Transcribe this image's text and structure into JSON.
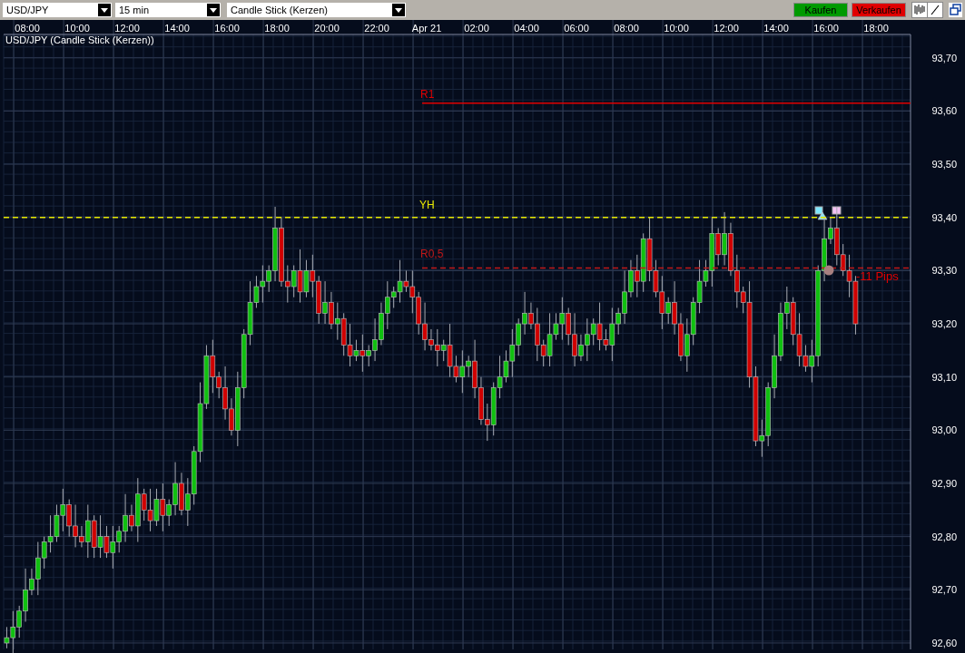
{
  "toolbar": {
    "selects": [
      {
        "value": "USD/JPY"
      },
      {
        "value": "15 min"
      },
      {
        "value": "Candle Stick (Kerzen)"
      }
    ],
    "buttons": [
      {
        "label": "Kaufen",
        "kind": "buy"
      },
      {
        "label": "Verkaufen",
        "kind": "sell"
      }
    ]
  },
  "chart": {
    "chart_data": {
      "type": "candlestick",
      "title": "USD/JPY (Candle Stick (Kerzen))",
      "categories": [
        null,
        null,
        null,
        "08:00",
        null,
        null,
        null,
        null,
        null,
        null,
        null,
        "10:00",
        null,
        null,
        null,
        null,
        null,
        null,
        null,
        "12:00",
        null,
        null,
        null,
        null,
        null,
        null,
        null,
        "14:00",
        null,
        null,
        null,
        null,
        null,
        null,
        null,
        "16:00",
        null,
        null,
        null,
        null,
        null,
        null,
        null,
        "18:00",
        null,
        null,
        null,
        null,
        null,
        null,
        null,
        "20:00",
        null,
        null,
        null,
        null,
        null,
        null,
        null,
        "22:00",
        null,
        null,
        null,
        null,
        null,
        null,
        null,
        "Apr 21",
        null,
        null,
        null,
        null,
        null,
        null,
        null,
        "02:00",
        null,
        null,
        null,
        null,
        null,
        null,
        null,
        "04:00",
        null,
        null,
        null,
        null,
        null,
        null,
        null,
        "06:00",
        null,
        null,
        null,
        null,
        null,
        null,
        null,
        "08:00",
        null,
        null,
        null,
        null,
        null,
        null,
        null,
        "10:00",
        null,
        null,
        null,
        null,
        null,
        null,
        null,
        "12:00",
        null,
        null,
        null,
        null,
        null,
        null,
        null,
        "14:00",
        null,
        null,
        null,
        null,
        null,
        null,
        null,
        "16:00",
        null,
        null,
        null,
        null,
        null,
        null,
        null,
        "18:00",
        null
      ],
      "ohlc": [
        [
          92.6,
          92.63,
          92.59,
          92.61
        ],
        [
          92.61,
          92.66,
          92.58,
          92.63
        ],
        [
          92.63,
          92.67,
          92.61,
          92.66
        ],
        [
          92.66,
          92.74,
          92.64,
          92.7
        ],
        [
          92.7,
          92.74,
          92.69,
          92.72
        ],
        [
          92.72,
          92.79,
          92.69,
          92.76
        ],
        [
          92.76,
          92.8,
          92.74,
          92.79
        ],
        [
          92.79,
          92.84,
          92.77,
          92.8
        ],
        [
          92.8,
          92.86,
          92.79,
          92.84
        ],
        [
          92.84,
          92.89,
          92.81,
          92.86
        ],
        [
          92.86,
          92.87,
          92.8,
          92.82
        ],
        [
          92.82,
          92.86,
          92.78,
          92.8
        ],
        [
          92.8,
          92.82,
          92.78,
          92.79
        ],
        [
          92.79,
          92.86,
          92.76,
          92.83
        ],
        [
          92.83,
          92.84,
          92.76,
          92.78
        ],
        [
          92.78,
          92.84,
          92.76,
          92.8
        ],
        [
          92.8,
          92.82,
          92.76,
          92.77
        ],
        [
          92.77,
          92.82,
          92.74,
          92.79
        ],
        [
          92.79,
          92.82,
          92.77,
          92.81
        ],
        [
          92.81,
          92.88,
          92.79,
          92.84
        ],
        [
          92.84,
          92.86,
          92.81,
          92.82
        ],
        [
          92.82,
          92.91,
          92.79,
          92.88
        ],
        [
          92.88,
          92.89,
          92.83,
          92.85
        ],
        [
          92.85,
          92.89,
          92.81,
          92.83
        ],
        [
          92.83,
          92.89,
          92.82,
          92.87
        ],
        [
          92.87,
          92.9,
          92.81,
          92.84
        ],
        [
          92.84,
          92.87,
          92.82,
          92.86
        ],
        [
          92.86,
          92.94,
          92.84,
          92.9
        ],
        [
          92.9,
          92.92,
          92.84,
          92.85
        ],
        [
          92.85,
          92.91,
          92.82,
          92.88
        ],
        [
          92.88,
          92.97,
          92.86,
          92.96
        ],
        [
          92.96,
          93.09,
          92.94,
          93.05
        ],
        [
          93.05,
          93.16,
          93.04,
          93.14
        ],
        [
          93.14,
          93.17,
          93.07,
          93.1
        ],
        [
          93.1,
          93.11,
          93.06,
          93.08
        ],
        [
          93.08,
          93.12,
          93.02,
          93.04
        ],
        [
          93.04,
          93.06,
          92.99,
          93.0
        ],
        [
          93.0,
          93.11,
          92.97,
          93.08
        ],
        [
          93.08,
          93.19,
          93.06,
          93.18
        ],
        [
          93.18,
          93.28,
          93.16,
          93.24
        ],
        [
          93.24,
          93.29,
          93.23,
          93.27
        ],
        [
          93.27,
          93.31,
          93.24,
          93.28
        ],
        [
          93.28,
          93.31,
          93.26,
          93.3
        ],
        [
          93.3,
          93.42,
          93.28,
          93.38
        ],
        [
          93.38,
          93.4,
          93.27,
          93.28
        ],
        [
          93.28,
          93.31,
          93.24,
          93.27
        ],
        [
          93.27,
          93.31,
          93.25,
          93.3
        ],
        [
          93.3,
          93.34,
          93.24,
          93.26
        ],
        [
          93.26,
          93.32,
          93.25,
          93.3
        ],
        [
          93.3,
          93.33,
          93.25,
          93.28
        ],
        [
          93.28,
          93.29,
          93.2,
          93.22
        ],
        [
          93.22,
          93.28,
          93.2,
          93.24
        ],
        [
          93.24,
          93.26,
          93.19,
          93.2
        ],
        [
          93.2,
          93.24,
          93.17,
          93.21
        ],
        [
          93.21,
          93.22,
          93.14,
          93.16
        ],
        [
          93.16,
          93.2,
          93.12,
          93.14
        ],
        [
          93.14,
          93.17,
          93.13,
          93.15
        ],
        [
          93.15,
          93.18,
          93.11,
          93.14
        ],
        [
          93.14,
          93.16,
          93.12,
          93.15
        ],
        [
          93.15,
          93.21,
          93.13,
          93.17
        ],
        [
          93.17,
          93.24,
          93.16,
          93.22
        ],
        [
          93.22,
          93.28,
          93.19,
          93.25
        ],
        [
          93.25,
          93.27,
          93.23,
          93.26
        ],
        [
          93.26,
          93.32,
          93.24,
          93.28
        ],
        [
          93.28,
          93.3,
          93.26,
          93.27
        ],
        [
          93.27,
          93.3,
          93.22,
          93.25
        ],
        [
          93.25,
          93.26,
          93.18,
          93.2
        ],
        [
          93.2,
          93.24,
          93.15,
          93.17
        ],
        [
          93.17,
          93.19,
          93.15,
          93.16
        ],
        [
          93.16,
          93.19,
          93.12,
          93.15
        ],
        [
          93.15,
          93.17,
          93.13,
          93.16
        ],
        [
          93.16,
          93.2,
          93.1,
          93.12
        ],
        [
          93.12,
          93.14,
          93.09,
          93.1
        ],
        [
          93.1,
          93.15,
          93.07,
          93.12
        ],
        [
          93.12,
          93.14,
          93.1,
          93.13
        ],
        [
          93.13,
          93.17,
          93.06,
          93.08
        ],
        [
          93.08,
          93.1,
          93.01,
          93.02
        ],
        [
          93.02,
          93.05,
          92.98,
          93.01
        ],
        [
          93.01,
          93.09,
          92.99,
          93.08
        ],
        [
          93.08,
          93.14,
          93.06,
          93.1
        ],
        [
          93.1,
          93.15,
          93.09,
          93.13
        ],
        [
          93.13,
          93.19,
          93.1,
          93.16
        ],
        [
          93.16,
          93.21,
          93.14,
          93.2
        ],
        [
          93.2,
          93.26,
          93.18,
          93.22
        ],
        [
          93.22,
          93.24,
          93.19,
          93.2
        ],
        [
          93.2,
          93.23,
          93.13,
          93.16
        ],
        [
          93.16,
          93.17,
          93.12,
          93.14
        ],
        [
          93.14,
          93.22,
          93.12,
          93.18
        ],
        [
          93.18,
          93.22,
          93.17,
          93.2
        ],
        [
          93.2,
          93.25,
          93.17,
          93.22
        ],
        [
          93.22,
          93.23,
          93.16,
          93.18
        ],
        [
          93.18,
          93.22,
          93.12,
          93.14
        ],
        [
          93.14,
          93.18,
          93.13,
          93.16
        ],
        [
          93.16,
          93.21,
          93.13,
          93.18
        ],
        [
          93.18,
          93.21,
          93.16,
          93.2
        ],
        [
          93.2,
          93.24,
          93.15,
          93.17
        ],
        [
          93.17,
          93.19,
          93.15,
          93.16
        ],
        [
          93.16,
          93.23,
          93.13,
          93.2
        ],
        [
          93.2,
          93.23,
          93.18,
          93.22
        ],
        [
          93.22,
          93.3,
          93.2,
          93.26
        ],
        [
          93.26,
          93.32,
          93.25,
          93.3
        ],
        [
          93.3,
          93.33,
          93.25,
          93.28
        ],
        [
          93.28,
          93.37,
          93.26,
          93.36
        ],
        [
          93.36,
          93.4,
          93.28,
          93.3
        ],
        [
          93.3,
          93.32,
          93.25,
          93.26
        ],
        [
          93.26,
          93.29,
          93.19,
          93.22
        ],
        [
          93.22,
          93.25,
          93.2,
          93.24
        ],
        [
          93.24,
          93.28,
          93.18,
          93.2
        ],
        [
          93.2,
          93.22,
          93.13,
          93.14
        ],
        [
          93.14,
          93.21,
          93.11,
          93.18
        ],
        [
          93.18,
          93.25,
          93.16,
          93.24
        ],
        [
          93.24,
          93.32,
          93.22,
          93.28
        ],
        [
          93.28,
          93.32,
          93.27,
          93.3
        ],
        [
          93.3,
          93.4,
          93.27,
          93.37
        ],
        [
          93.37,
          93.38,
          93.31,
          93.33
        ],
        [
          93.33,
          93.41,
          93.31,
          93.37
        ],
        [
          93.37,
          93.39,
          93.29,
          93.3
        ],
        [
          93.3,
          93.33,
          93.23,
          93.26
        ],
        [
          93.26,
          93.27,
          93.22,
          93.24
        ],
        [
          93.24,
          93.28,
          93.08,
          93.1
        ],
        [
          93.1,
          93.12,
          92.97,
          92.98
        ],
        [
          92.98,
          93.02,
          92.95,
          92.99
        ],
        [
          92.99,
          93.09,
          92.97,
          93.08
        ],
        [
          93.08,
          93.18,
          93.06,
          93.14
        ],
        [
          93.14,
          93.24,
          93.13,
          93.22
        ],
        [
          93.22,
          93.27,
          93.19,
          93.24
        ],
        [
          93.24,
          93.25,
          93.16,
          93.18
        ],
        [
          93.18,
          93.22,
          93.12,
          93.14
        ],
        [
          93.14,
          93.16,
          93.11,
          93.12
        ],
        [
          93.12,
          93.17,
          93.09,
          93.14
        ],
        [
          93.14,
          93.31,
          93.12,
          93.3
        ],
        [
          93.3,
          93.4,
          93.28,
          93.36
        ],
        [
          93.36,
          93.4,
          93.35,
          93.38
        ],
        [
          93.38,
          93.42,
          93.31,
          93.33
        ],
        [
          93.33,
          93.35,
          93.29,
          93.3
        ],
        [
          93.3,
          93.33,
          93.25,
          93.28
        ],
        [
          93.28,
          93.29,
          93.18,
          93.2
        ],
        null,
        null,
        null,
        null
      ],
      "ylim": [
        92.588,
        93.744
      ],
      "grid": true,
      "ref_lines": [
        {
          "axis": "y",
          "value": 93.615,
          "label": "R1",
          "color": "#e00000"
        },
        {
          "axis": "y",
          "value": 93.4,
          "label": "YH",
          "color": "#e8e800"
        },
        {
          "axis": "y",
          "value": 93.305,
          "label": "R0,5",
          "color": "#c01818"
        }
      ],
      "yticks": [
        {
          "value": 93.7,
          "label": "93,70"
        },
        {
          "value": 93.6,
          "label": "93,60"
        },
        {
          "value": 93.5,
          "label": "93,50"
        },
        {
          "value": 93.4,
          "label": "93,40"
        },
        {
          "value": 93.3,
          "label": "93,30"
        },
        {
          "value": 93.2,
          "label": "93,20"
        },
        {
          "value": 93.1,
          "label": "93,10"
        },
        {
          "value": 93.0,
          "label": "93,00"
        },
        {
          "value": 92.9,
          "label": "92,90"
        },
        {
          "value": 92.8,
          "label": "92,80"
        },
        {
          "value": 92.7,
          "label": "92,70"
        },
        {
          "value": 92.6,
          "label": "92,60"
        }
      ]
    },
    "level_styles": [
      {
        "kind": "solid"
      },
      {
        "kind": "dashed"
      },
      {
        "kind": "dashed"
      }
    ],
    "annotation": "-11 Pips"
  }
}
